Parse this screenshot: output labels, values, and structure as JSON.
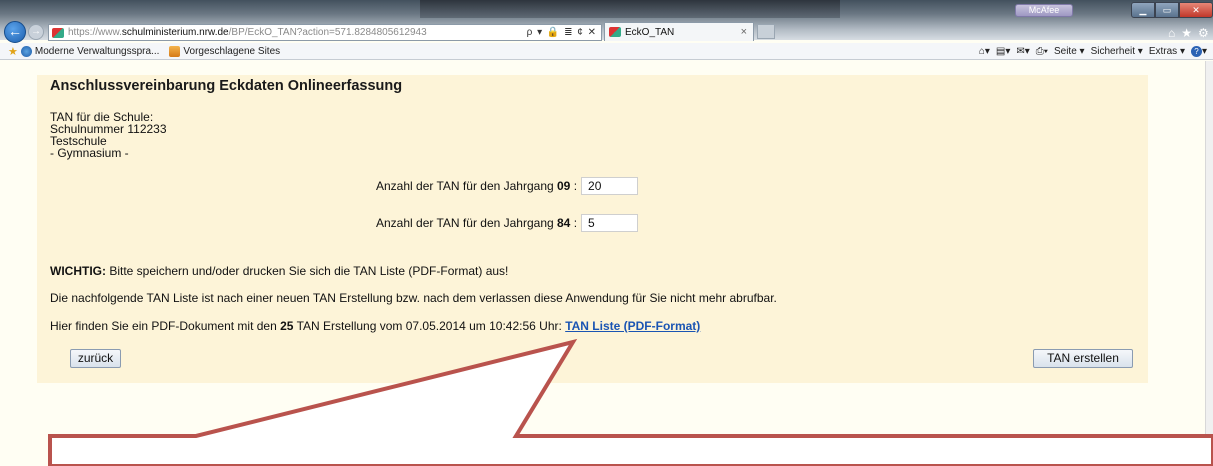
{
  "browser": {
    "url_prefix": "https://www.",
    "url_domain": "schulministerium.nrw.de",
    "url_path": "/BP/EckO_TAN?action=571.8284805612943",
    "url_tools": "ρ ▾ 🔒 ≣ ¢ ✕",
    "tab_title": "EckO_TAN",
    "tab_close": "×",
    "mcafee": "McAfee",
    "favorites": [
      "Moderne Verwaltungsspra...",
      "Vorgeschlagene Sites"
    ],
    "commands": [
      "Seite ▾",
      "Sicherheit ▾",
      "Extras ▾"
    ],
    "help_glyph": "?"
  },
  "page": {
    "title": "Anschlussvereinbarung Eckdaten Onlineerfassung",
    "school_lines": [
      "TAN für die Schule:",
      "Schulnummer 112233",
      "Testschule",
      "- Gymnasium -"
    ],
    "tan_rows": [
      {
        "label_prefix": "Anzahl der TAN für den Jahrgang ",
        "jahrgang": "09",
        "label_suffix": " :",
        "value": "20"
      },
      {
        "label_prefix": "Anzahl der TAN für den Jahrgang ",
        "jahrgang": "84",
        "label_suffix": " :",
        "value": "5"
      }
    ],
    "important_label": "WICHTIG:",
    "important_text": " Bitte speichern und/oder drucken Sie sich die TAN Liste (PDF-Format) aus!",
    "notice": "Die nachfolgende TAN Liste ist nach einer neuen TAN Erstellung bzw. nach dem verlassen diese Anwendung für Sie nicht mehr abrufbar.",
    "pdf_prefix": "Hier finden Sie ein PDF-Dokument mit den ",
    "pdf_count": "25",
    "pdf_middle": " TAN Erstellung vom 07.05.2014 um 10:42:56 Uhr: ",
    "pdf_link": "TAN Liste (PDF-Format)",
    "back_button": "zurück",
    "create_button": "TAN erstellen"
  },
  "colors": {
    "panel_bg": "#fdf4d8",
    "page_bg": "#fffef3",
    "link": "#1a54b3",
    "callout_stroke": "#b9534d"
  }
}
